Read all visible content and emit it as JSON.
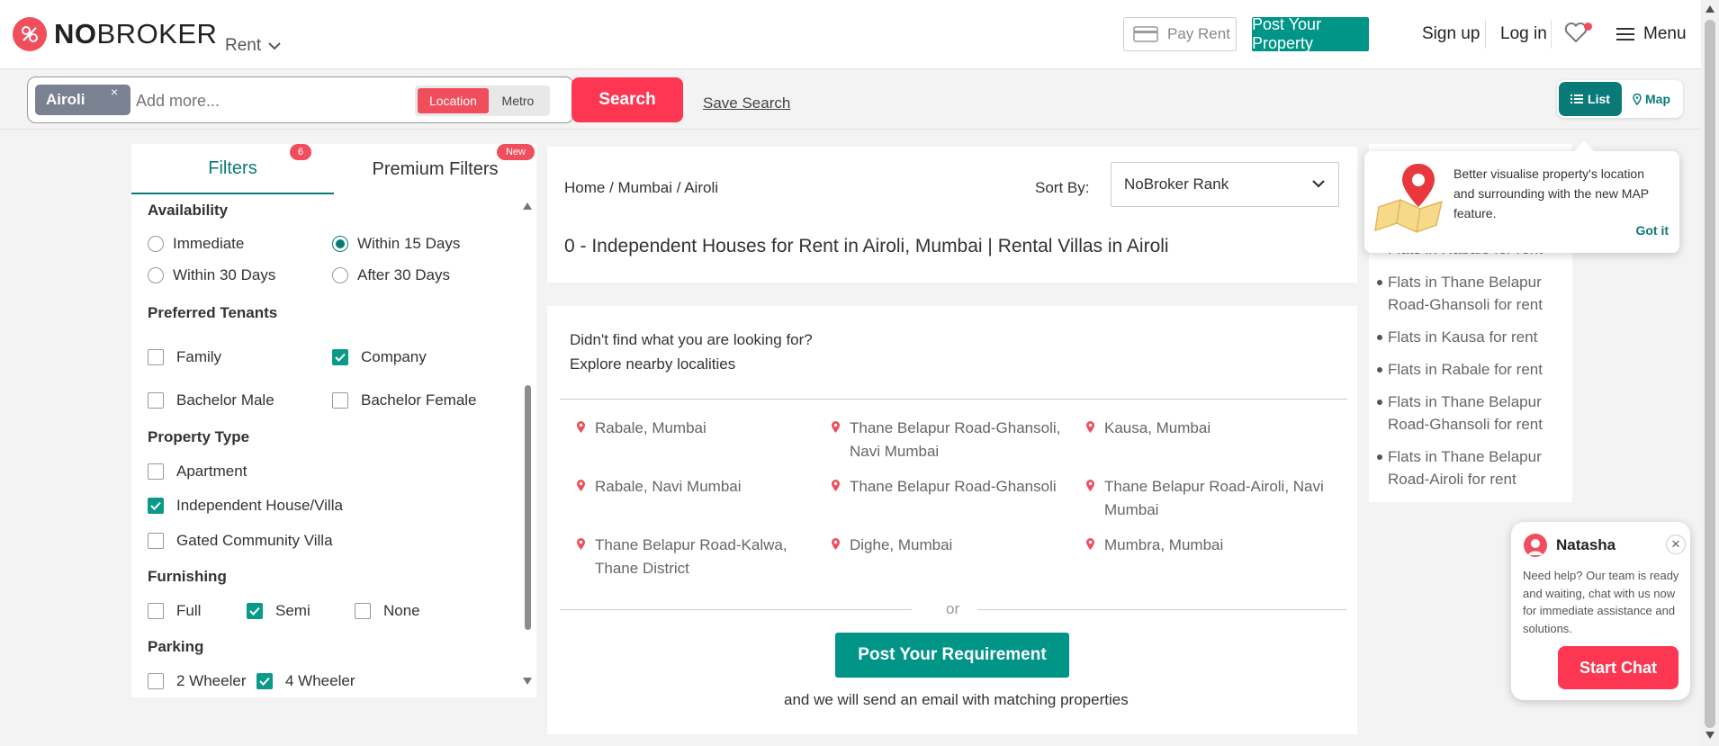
{
  "header": {
    "logo_bold": "NO",
    "logo_light": "BROKER",
    "rent_dropdown": "Rent",
    "pay_rent": "Pay Rent",
    "post_property": "Post Your Property",
    "sign_up": "Sign up",
    "log_in": "Log in",
    "menu": "Menu"
  },
  "search": {
    "chip": "Airoli",
    "chip_remove": "×",
    "placeholder": "Add more...",
    "toggle_location": "Location",
    "toggle_metro": "Metro",
    "search_button": "Search",
    "save_search": "Save Search",
    "view_list": "List",
    "view_map": "Map"
  },
  "filters": {
    "tab_filters": "Filters",
    "tab_filters_badge": "6",
    "tab_premium": "Premium Filters",
    "tab_premium_badge": "New",
    "availability": {
      "heading": "Availability",
      "options": [
        {
          "label": "Immediate",
          "selected": false
        },
        {
          "label": "Within 15 Days",
          "selected": true
        },
        {
          "label": "Within 30 Days",
          "selected": false
        },
        {
          "label": "After 30 Days",
          "selected": false
        }
      ]
    },
    "tenants": {
      "heading": "Preferred Tenants",
      "options": [
        {
          "label": "Family",
          "checked": false
        },
        {
          "label": "Company",
          "checked": true
        },
        {
          "label": "Bachelor Male",
          "checked": false
        },
        {
          "label": "Bachelor Female",
          "checked": false
        }
      ]
    },
    "property_type": {
      "heading": "Property Type",
      "options": [
        {
          "label": "Apartment",
          "checked": false
        },
        {
          "label": "Independent House/Villa",
          "checked": true
        },
        {
          "label": "Gated Community Villa",
          "checked": false
        }
      ]
    },
    "furnishing": {
      "heading": "Furnishing",
      "options": [
        {
          "label": "Full",
          "checked": false
        },
        {
          "label": "Semi",
          "checked": true
        },
        {
          "label": "None",
          "checked": false
        }
      ]
    },
    "parking": {
      "heading": "Parking",
      "options": [
        {
          "label": "2 Wheeler",
          "checked": false
        },
        {
          "label": "4 Wheeler",
          "checked": true
        }
      ]
    }
  },
  "main": {
    "breadcrumb": "Home  / Mumbai / Airoli",
    "sort_label": "Sort By:",
    "sort_value": "NoBroker Rank",
    "title": "0 - Independent Houses for Rent in Airoli, Mumbai | Rental Villas in Airoli",
    "not_found_line1": "Didn't find what you are looking for?",
    "not_found_line2": "Explore nearby localities",
    "localities": [
      "Rabale, Mumbai",
      "Thane Belapur Road-Ghansoli, Navi Mumbai",
      "Kausa, Mumbai",
      "Rabale, Navi Mumbai",
      "Thane Belapur Road-Ghansoli",
      "Thane Belapur Road-Airoli, Navi Mumbai",
      "Thane Belapur Road-Kalwa, Thane District",
      "Dighe, Mumbai",
      "Mumbra, Mumbai"
    ],
    "or": "or",
    "post_requirement": "Post Your Requirement",
    "requirement_note": "and we will send an email with matching properties"
  },
  "sidebar_links": [
    "Flats in Rabale for rent",
    "Flats in Thane Belapur Road-Ghansoli for rent",
    "Flats in Kausa for rent",
    "Flats in Rabale for rent",
    "Flats in Thane Belapur Road-Ghansoli for rent",
    "Flats in Thane Belapur Road-Airoli for rent"
  ],
  "map_tooltip": {
    "text": "Better visualise property's location and surrounding with the new MAP feature.",
    "got_it": "Got it"
  },
  "chat": {
    "name": "Natasha",
    "message": "Need help? Our team is ready and waiting, chat with us now for immediate assistance and solutions.",
    "button": "Start Chat"
  },
  "colors": {
    "brand_red": "#fd3752",
    "brand_teal": "#009587",
    "accent_teal": "#0a7a78"
  }
}
